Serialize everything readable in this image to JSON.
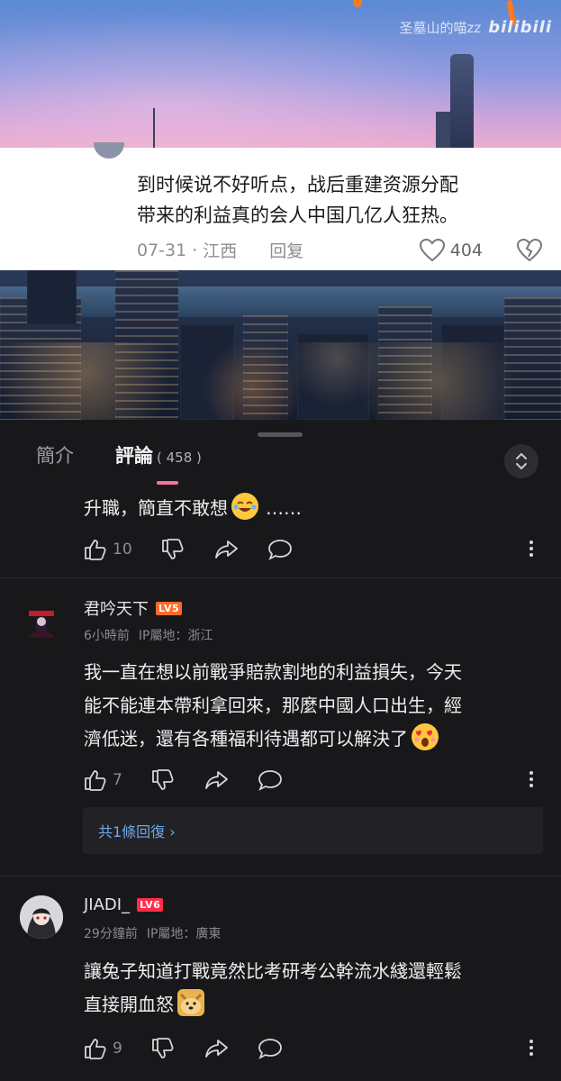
{
  "video": {
    "uploader": "圣墓山的喵zz",
    "site_logo": "bilibili"
  },
  "embedded_comment": {
    "text_line1": "到时候说不好听点，战后重建资源分配",
    "text_line2": "带来的利益真的会人中国几亿人狂热。",
    "date": "07-31",
    "location": "江西",
    "reply_label": "回复",
    "likes": "404"
  },
  "tabs": {
    "intro_label": "簡介",
    "comments_label": "評論",
    "comments_count": "( 458 )"
  },
  "comments": [
    {
      "text": "升職，簡直不敢想",
      "emoji": "crying-laugh-emoji",
      "trailing": "……",
      "likes": "10"
    },
    {
      "username": "君吟天下",
      "level": "LV5",
      "time": "6小時前",
      "ip_label": "IP屬地：浙江",
      "text_line1": "我一直在想以前戰爭賠款割地的利益損失，今天",
      "text_line2": "能不能連本帶利拿回來，那麼中國人口出生，經",
      "text_line3": "濟低迷，還有各種福利待遇都可以解決了",
      "emoji": "heart-eyes-emoji",
      "likes": "7",
      "replies_link": "共1條回復 ›"
    },
    {
      "username": "JIADI_",
      "level": "LV6",
      "time": "29分鐘前",
      "ip_label": "IP屬地：廣東",
      "text_line1": "讓兔子知道打戰竟然比考研考公幹流水綫還輕鬆",
      "text_line2": "直接開血怒",
      "emoji": "doge-emoji",
      "likes": "9"
    }
  ],
  "colors": {
    "accent_pink": "#fb7299",
    "link_blue": "#6fa7e8",
    "lv5": "#ff6a2b",
    "lv6": "#ff2d4a"
  }
}
